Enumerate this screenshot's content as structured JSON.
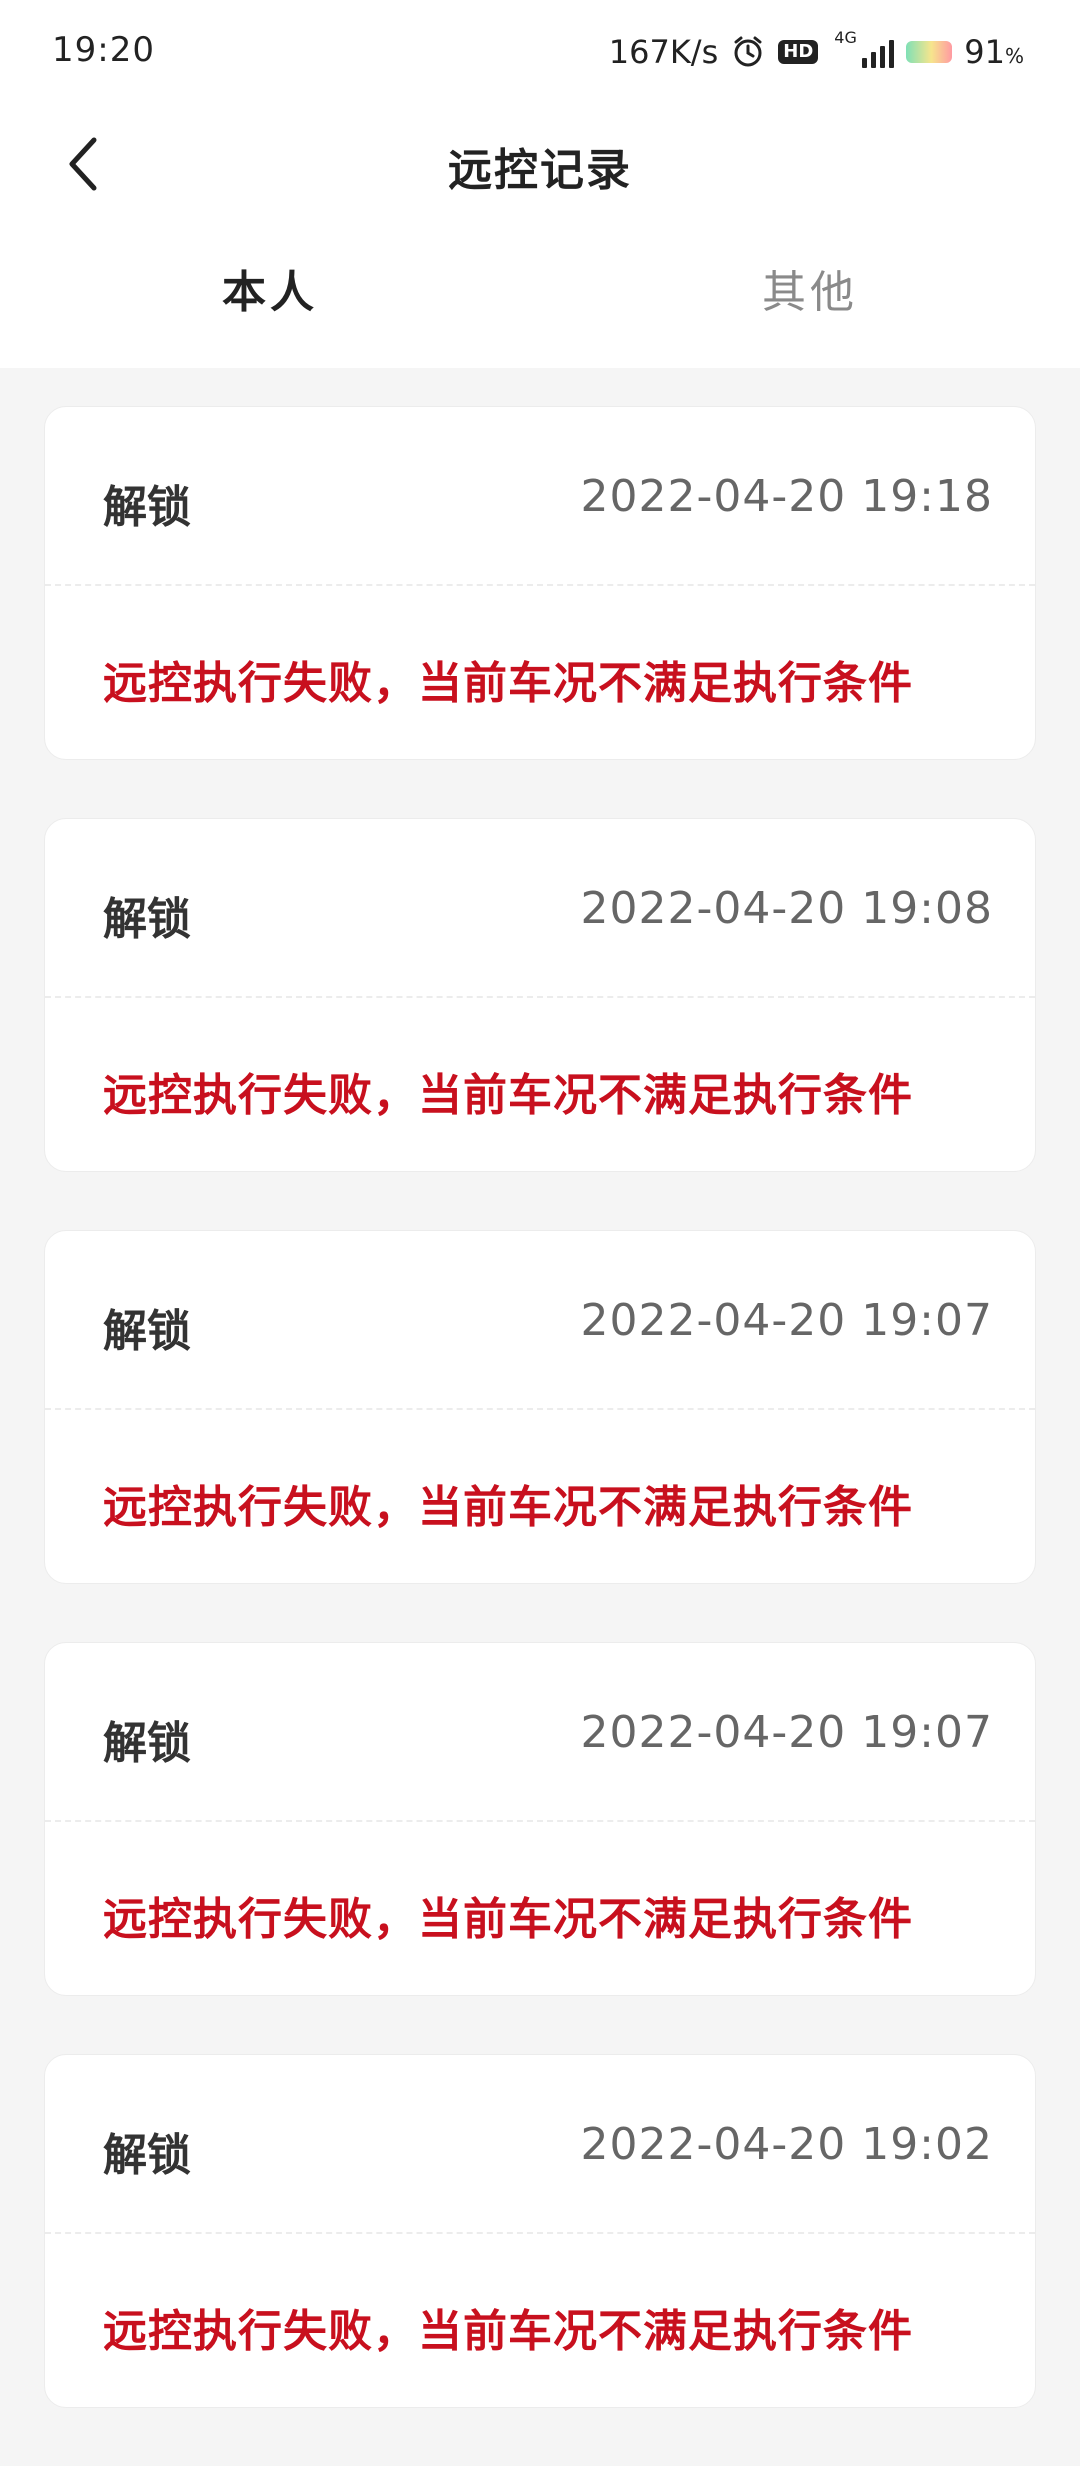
{
  "status_bar": {
    "time": "19:20",
    "speed": "167K/s",
    "hd": "HD",
    "network": "4G",
    "battery_percent": "91",
    "battery_unit": "%"
  },
  "header": {
    "title": "远控记录"
  },
  "tabs": [
    {
      "label": "本人",
      "active": true
    },
    {
      "label": "其他",
      "active": false
    }
  ],
  "records": [
    {
      "action": "解锁",
      "time": "2022-04-20 19:18",
      "result": "远控执行失败，当前车况不满足执行条件"
    },
    {
      "action": "解锁",
      "time": "2022-04-20 19:08",
      "result": "远控执行失败，当前车况不满足执行条件"
    },
    {
      "action": "解锁",
      "time": "2022-04-20 19:07",
      "result": "远控执行失败，当前车况不满足执行条件"
    },
    {
      "action": "解锁",
      "time": "2022-04-20 19:07",
      "result": "远控执行失败，当前车况不满足执行条件"
    },
    {
      "action": "解锁",
      "time": "2022-04-20 19:02",
      "result": "远控执行失败，当前车况不满足执行条件"
    }
  ],
  "colors": {
    "result_text": "#c8101e",
    "background": "#f5f5f5",
    "card": "#ffffff"
  },
  "icons": {
    "back": "chevron-left-icon",
    "alarm": "alarm-clock-icon",
    "signal": "signal-bars-icon",
    "battery": "battery-icon"
  }
}
